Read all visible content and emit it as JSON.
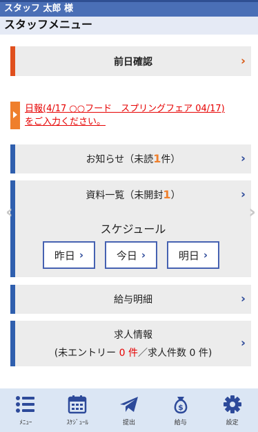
{
  "header": {
    "user_name": "スタッフ 太郎 様",
    "title": "スタッフメニュー"
  },
  "prev_day": {
    "label": "前日確認"
  },
  "notice": {
    "line1": "日報(4/17 ○○フード　スプリングフェア 04/17)",
    "line2": "をご入力ください。"
  },
  "news": {
    "prefix": "お知らせ（未読",
    "count": "1",
    "suffix": "件）"
  },
  "documents": {
    "prefix": "資料一覧（未開封",
    "count": "1",
    "suffix": "）"
  },
  "schedule": {
    "heading": "スケジュール",
    "yesterday": "昨日",
    "today": "今日",
    "tomorrow": "明日"
  },
  "salary": {
    "label": "給与明細"
  },
  "jobs": {
    "title": "求人情報",
    "prefix": "(未エントリー",
    "entry_count": "0",
    "unit1": "件",
    "middle": "／求人件数",
    "job_count": "0",
    "suffix": "件)"
  },
  "nav": [
    {
      "label": "ﾒﾆｭｰ",
      "icon": "menu-list-icon"
    },
    {
      "label": "ｽｹｼﾞｭｰﾙ",
      "icon": "calendar-icon"
    },
    {
      "label": "提出",
      "icon": "paper-plane-icon"
    },
    {
      "label": "給与",
      "icon": "money-bag-icon"
    },
    {
      "label": "設定",
      "icon": "gear-icon"
    }
  ],
  "colors": {
    "header": "#4a6fb6",
    "accent": "#2f5fae",
    "orange": "#ef7f2c",
    "alert": "#e60000",
    "footer": "#dbe6f4"
  }
}
